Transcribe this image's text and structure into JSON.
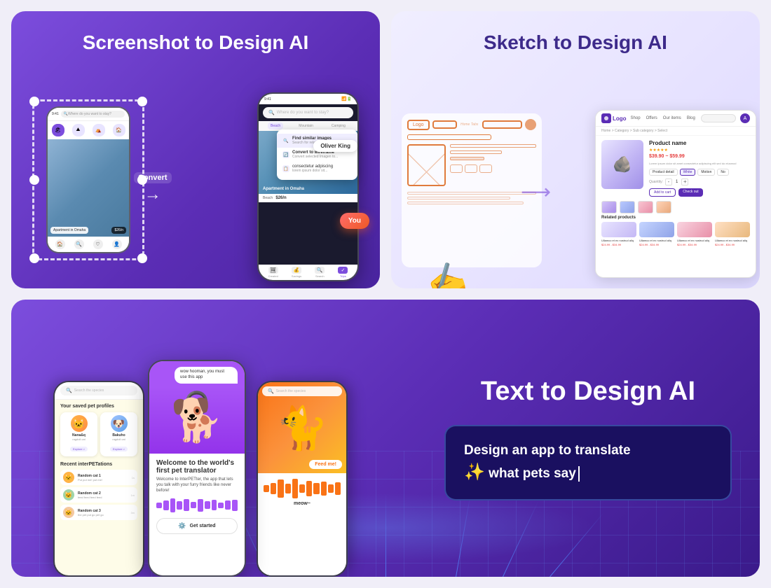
{
  "cards": {
    "screenshot_card": {
      "title": "Screenshot to\nDesign AI",
      "convert_label": "Convert",
      "phone_small": {
        "search_placeholder": "Where do you want to stay?",
        "image_label": "Apartment in Omaha",
        "price": "$26/n"
      },
      "phone_main": {
        "search_placeholder": "Where do you want to stay?",
        "tabs": [
          "Beach",
          "Mountain",
          "Camping"
        ],
        "image_caption": "Apartment in Omaha",
        "image_sub": "Beach",
        "image_price": "$26/n"
      },
      "context_menu": [
        {
          "icon": "🔍",
          "text": "Find similar images",
          "desc": "Search for related images"
        },
        {
          "icon": "🔄",
          "text": "Convert to wireframe",
          "desc": "Convert selected Imagen to..."
        },
        {
          "icon": "📋",
          "text": "lorem ipsum dolor sit",
          "desc": "consectetur adipiscing"
        }
      ],
      "oliver_label": "Oliver King",
      "you_label": "You"
    },
    "sketch_card": {
      "title": "Sketch to Design AI",
      "product": {
        "name": "Product name",
        "stars": "★★★★★",
        "price": "$39.90 ~ $59.99",
        "desc": "Lorem ipsum dolor sit amet consectetur adipiscing elit sed do eiusmod",
        "options": [
          "Product detail",
          "White",
          "Motion",
          "No"
        ],
        "qty_label": "Quantity:",
        "qty_value": "1",
        "add_btn": "Add to cart",
        "checkout_btn": "Check out"
      },
      "breadcrumb": "Home > Category > Sub category > Select",
      "related_title": "Related products",
      "related_items": [
        {
          "name": "Ullamco et ex nostrud aliq",
          "price": "$24.99 - $34.99"
        },
        {
          "name": "Ullamco et ex nostrud aliq",
          "price": "$24.99 - $34.99"
        },
        {
          "name": "Ullamco et ex nostrud aliq",
          "price": "$24.99 - $34.99"
        },
        {
          "name": "Ullamco et ex nostrud aliq",
          "price": "$24.99 - $34.99"
        }
      ]
    },
    "text_design_card": {
      "title": "Text to Design AI",
      "prompt_line1": "Design an app to translate",
      "prompt_sparkle": "✨",
      "prompt_line2": "what pets say",
      "phone1": {
        "search_placeholder": "Search the species",
        "section_saved": "Your saved pet profiles",
        "pets": [
          {
            "name": "Nana&q",
            "breed": "ragdoll cat",
            "emoji": "🐱"
          },
          {
            "name": "Bakuho",
            "breed": "ragdoll cat",
            "emoji": "🐶"
          }
        ],
        "section_recent": "Recent interPETations",
        "recent_items": [
          {
            "name": "Random cat 1",
            "msg": "Put put me! put me!",
            "time": "1s"
          },
          {
            "name": "Random cat 2",
            "msg": "feed feed feed feed",
            "time": "1m"
          },
          {
            "name": "Random cat 3",
            "msg": "the pet put go pet go",
            "time": "3m"
          }
        ]
      },
      "phone2": {
        "chat_bubble": "wow hooman, you must use this app",
        "app_title": "Welcome to the world's\nfirst pet translator",
        "app_subtitle": "Welcome to InterPETter, the app that lets you talk with your furry friends like never before!",
        "get_started": "Get started"
      },
      "phone3": {
        "search_placeholder": "Search the species",
        "feed_btn": "Feed me!",
        "translation": "meow~"
      }
    }
  }
}
